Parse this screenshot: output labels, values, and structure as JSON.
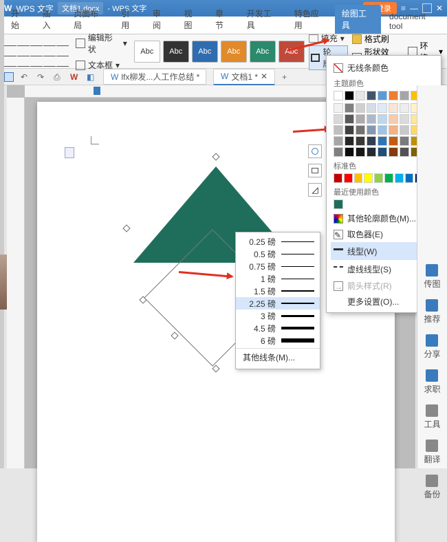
{
  "titlebar": {
    "app": "WPS 文字",
    "doc": "文档1.docx",
    "suffix": "- WPS 文字",
    "login": "未登录"
  },
  "tabs": {
    "items": [
      "开始",
      "插入",
      "页面布局",
      "引用",
      "审阅",
      "视图",
      "章节",
      "开发工具",
      "特色应用",
      "绘图工具",
      "document tool"
    ],
    "active": 9
  },
  "ribbon": {
    "edit_shape": "编辑形状",
    "textbox": "文本框",
    "styles": [
      "Abc",
      "Abc",
      "Abc",
      "Abc",
      "Abc",
      "Abc"
    ],
    "fill": "填充",
    "outline": "轮廓",
    "format_brush": "格式刷",
    "shape_effects": "形状效果",
    "wrap": "环绕"
  },
  "doctabs": {
    "items": [
      "lfx柳发...人工作总结 *",
      "文档1 *"
    ],
    "active": 1
  },
  "color_popup": {
    "no_line": "无线条颜色",
    "theme": "主题颜色",
    "standard": "标准色",
    "recent": "最近使用颜色",
    "other_outline": "其他轮廓颜色(M)...",
    "eyedropper": "取色器(E)",
    "line_type": "线型(W)",
    "dash_type": "虚线线型(S)",
    "arrow_style": "箭头样式(R)",
    "more_settings": "更多设置(O)...",
    "theme_row1": [
      "#ffffff",
      "#000000",
      "#e7e6e6",
      "#44546a",
      "#5b9bd5",
      "#ed7d31",
      "#a5a5a5",
      "#ffc000",
      "#4472c4",
      "#70ad47"
    ],
    "theme_shades": [
      [
        "#f2f2f2",
        "#808080",
        "#d0cece",
        "#d6dce5",
        "#deebf7",
        "#fbe5d6",
        "#ededed",
        "#fff2cc",
        "#d9e2f3",
        "#e2f0d9"
      ],
      [
        "#d9d9d9",
        "#595959",
        "#aeabab",
        "#adb9ca",
        "#bdd7ee",
        "#f8cbad",
        "#dbdbdb",
        "#ffe699",
        "#b4c7e7",
        "#c5e0b4"
      ],
      [
        "#bfbfbf",
        "#404040",
        "#757171",
        "#8497b0",
        "#9dc3e6",
        "#f4b183",
        "#c9c9c9",
        "#ffd966",
        "#8faadc",
        "#a9d18e"
      ],
      [
        "#a6a6a6",
        "#262626",
        "#3b3838",
        "#333f50",
        "#2e75b6",
        "#c55a11",
        "#7b7b7b",
        "#bf9000",
        "#2f5597",
        "#548235"
      ],
      [
        "#7f7f7f",
        "#0d0d0d",
        "#171717",
        "#222a35",
        "#1f4e79",
        "#843c0c",
        "#525252",
        "#806000",
        "#1f3864",
        "#385723"
      ]
    ],
    "standard_colors": [
      "#c00000",
      "#ff0000",
      "#ffc000",
      "#ffff00",
      "#92d050",
      "#00b050",
      "#00b0f0",
      "#0070c0",
      "#002060",
      "#7030a0"
    ],
    "recent_colors": [
      "#1f6e5c"
    ]
  },
  "linewidth": {
    "unit": "磅",
    "items": [
      0.25,
      0.5,
      0.75,
      1,
      1.5,
      2.25,
      3,
      4.5,
      6
    ],
    "hover_index": 5,
    "other": "其他线条(M)..."
  },
  "sidepanel": {
    "items": [
      "传图",
      "推荐",
      "分享",
      "求职",
      "工具",
      "翻译",
      "备份"
    ]
  }
}
